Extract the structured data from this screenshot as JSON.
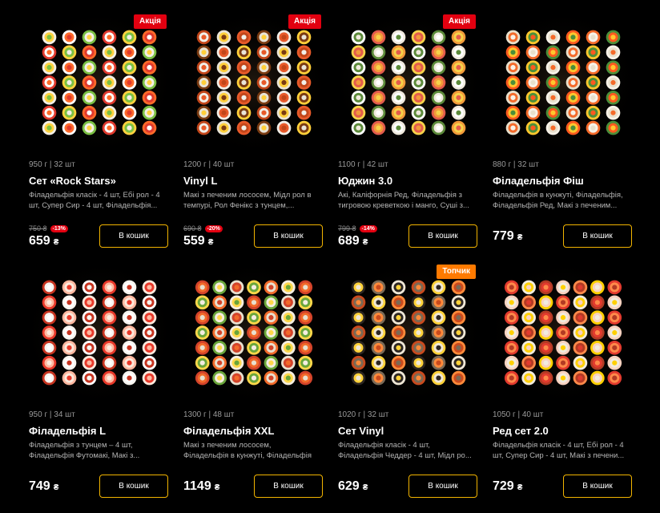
{
  "currency": "₴",
  "cart_label": "В кошик",
  "products": [
    {
      "badge": "Акція",
      "badge_color": "#e20010",
      "meta": "950 г | 32 шт",
      "name": "Сет «Rock Stars»",
      "desc": "Філадельфія класік - 4 шт, Ебі рол - 4 шт, Супер Сир - 4 шт, Філадельфія...",
      "old_price": "750 ₴",
      "discount": "-13%",
      "price": "659"
    },
    {
      "badge": "Акція",
      "badge_color": "#e20010",
      "meta": "1200 г | 40 шт",
      "name": "Vinyl L",
      "desc": "Макі з печеним лососем, Мідл рол в темпурі, Рол Фенікс з тунцем,...",
      "old_price": "690 ₴",
      "discount": "-20%",
      "price": "559"
    },
    {
      "badge": "Акція",
      "badge_color": "#e20010",
      "meta": "1100 г | 42 шт",
      "name": "Юджин 3.0",
      "desc": "Акі, Каліфорнія Ред, Філадельфія з тигровою креветкою і манго, Суші з...",
      "old_price": "799 ₴",
      "discount": "-14%",
      "price": "689"
    },
    {
      "badge": "",
      "badge_color": "",
      "meta": "880 г | 32 шт",
      "name": "Філадельфія Фіш",
      "desc": "Філадельфія в кунжуті, Філадельфія, Філадельфія Ред, Макі з печеним...",
      "old_price": "",
      "discount": "",
      "price": "779"
    },
    {
      "badge": "",
      "badge_color": "",
      "meta": "950 г | 34 шт",
      "name": "Філадельфія L",
      "desc": "Філадельфія з тунцем – 4 шт, Філадельфія Футомакі, Макі з...",
      "old_price": "",
      "discount": "",
      "price": "749"
    },
    {
      "badge": "",
      "badge_color": "",
      "meta": "1300 г | 48 шт",
      "name": "Філадельфія XXL",
      "desc": "Макі з печеним лососем, Філадельфія в кунжуті, Філадельфія Ред...",
      "old_price": "",
      "discount": "",
      "price": "1149"
    },
    {
      "badge": "Топчик",
      "badge_color": "#ff7a00",
      "meta": "1020 г | 32 шт",
      "name": "Сет Vinyl",
      "desc": "Філадельфія класік - 4 шт, Філадельфія Чеддер - 4 шт, Мідл ро...",
      "old_price": "",
      "discount": "",
      "price": "629"
    },
    {
      "badge": "",
      "badge_color": "",
      "meta": "1050 г | 40 шт",
      "name": "Ред сет 2.0",
      "desc": "Філадельфія класік - 4 шт, Ебі рол - 4 шт, Супер Сир - 4 шт, Макі з печени...",
      "old_price": "",
      "discount": "",
      "price": "729"
    }
  ]
}
